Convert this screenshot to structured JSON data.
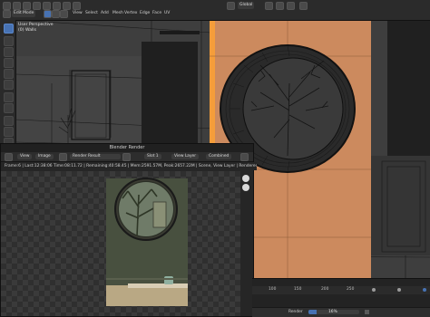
{
  "header": {
    "mode": "Edit Mode",
    "menus": [
      "View",
      "Select",
      "Add",
      "Mesh",
      "Vertex",
      "Edge",
      "Face",
      "UV"
    ],
    "orientation": "Global"
  },
  "viewport": {
    "view_name": "User Perspective",
    "object_name": "(0) Walls"
  },
  "render_window": {
    "title": "Blender Render",
    "menus": [
      "View",
      "Image"
    ],
    "image_name": "Render Result",
    "slot": "Slot 1",
    "view_layer": "View Layer",
    "pass": "Combined",
    "status": "Frame:6 | Last:12:38:06 Time:08:11.72 | Remaining:40:58.45 | Mem:2591.57M, Peak:2657.22M | Scene, View Layer | Rendered 73/480 Tiles, Sample 71/128"
  },
  "timeline": {
    "frame_ticks": [
      "100",
      "150",
      "200",
      "250"
    ],
    "status": "Render",
    "progress_percent": "16%",
    "progress_value": 0.16
  },
  "colors": {
    "accent": "#4772b3",
    "selection_orange": "#f59d3a",
    "wall_orange": "#cc8a5e"
  }
}
